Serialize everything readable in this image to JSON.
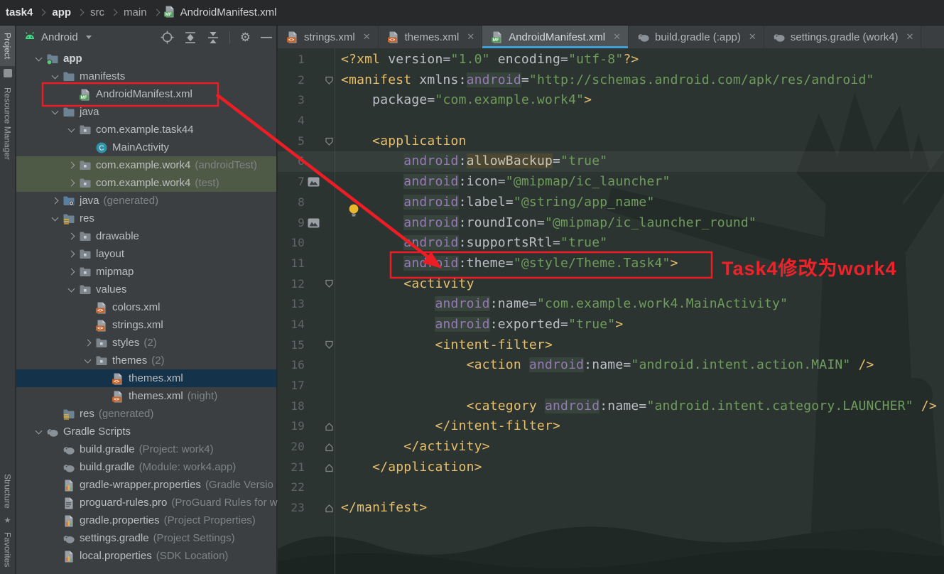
{
  "breadcrumb": {
    "path": [
      "task4",
      "app",
      "src",
      "main"
    ],
    "file": "AndroidManifest.xml"
  },
  "tool_strip": {
    "top": [
      {
        "label": "Project",
        "active": true
      },
      {
        "label": "Resource Manager",
        "active": false
      }
    ],
    "bottom": [
      {
        "label": "Structure",
        "active": false
      },
      {
        "label": "Favorites",
        "active": false
      }
    ]
  },
  "project_panel": {
    "view_selector": "Android",
    "toolbar_icons": [
      "locate",
      "expand-all",
      "collapse-all",
      "settings",
      "hide"
    ],
    "tree": [
      {
        "label": "app",
        "icon": "app-folder",
        "lvl": 0,
        "chev": "open",
        "bold": true
      },
      {
        "label": "manifests",
        "icon": "folder",
        "lvl": 1,
        "chev": "open"
      },
      {
        "label": "AndroidManifest.xml",
        "icon": "mf-file",
        "lvl": 2,
        "boxed": true
      },
      {
        "label": "java",
        "icon": "folder",
        "lvl": 1,
        "chev": "open"
      },
      {
        "label": "com.example.task44",
        "icon": "package",
        "lvl": 2,
        "chev": "open"
      },
      {
        "label": "MainActivity",
        "icon": "class",
        "lvl": 3
      },
      {
        "label": "com.example.work4",
        "suffix": "(androidTest)",
        "icon": "package",
        "lvl": 2,
        "chev": "closed",
        "state": "test-root"
      },
      {
        "label": "com.example.work4",
        "suffix": "(test)",
        "icon": "package",
        "lvl": 2,
        "chev": "closed",
        "state": "test-root"
      },
      {
        "label": "java",
        "suffix": "(generated)",
        "icon": "gen-folder",
        "lvl": 1,
        "chev": "closed"
      },
      {
        "label": "res",
        "icon": "res-folder",
        "lvl": 1,
        "chev": "open"
      },
      {
        "label": "drawable",
        "icon": "package",
        "lvl": 2,
        "chev": "closed"
      },
      {
        "label": "layout",
        "icon": "package",
        "lvl": 2,
        "chev": "closed"
      },
      {
        "label": "mipmap",
        "icon": "package",
        "lvl": 2,
        "chev": "closed"
      },
      {
        "label": "values",
        "icon": "package",
        "lvl": 2,
        "chev": "open"
      },
      {
        "label": "colors.xml",
        "icon": "xml-file",
        "lvl": 3
      },
      {
        "label": "strings.xml",
        "icon": "xml-file",
        "lvl": 3
      },
      {
        "label": "styles",
        "suffix": "(2)",
        "icon": "package",
        "lvl": 3,
        "chev": "closed"
      },
      {
        "label": "themes",
        "suffix": "(2)",
        "icon": "package",
        "lvl": 3,
        "chev": "open"
      },
      {
        "label": "themes.xml",
        "icon": "xml-file",
        "lvl": 4,
        "state": "selected"
      },
      {
        "label": "themes.xml",
        "suffix": "(night)",
        "icon": "xml-file",
        "lvl": 4
      },
      {
        "label": "res",
        "suffix": "(generated)",
        "icon": "res-folder",
        "lvl": 1
      },
      {
        "label": "Gradle Scripts",
        "icon": "gradle",
        "lvl": 0,
        "chev": "open"
      },
      {
        "label": "build.gradle",
        "suffix": "(Project: work4)",
        "icon": "gradle",
        "lvl": 1
      },
      {
        "label": "build.gradle",
        "suffix": "(Module: work4.app)",
        "icon": "gradle",
        "lvl": 1
      },
      {
        "label": "gradle-wrapper.properties",
        "suffix": "(Gradle Versio",
        "icon": "props",
        "lvl": 1
      },
      {
        "label": "proguard-rules.pro",
        "suffix": "(ProGuard Rules for w",
        "icon": "pro",
        "lvl": 1
      },
      {
        "label": "gradle.properties",
        "suffix": "(Project Properties)",
        "icon": "props",
        "lvl": 1
      },
      {
        "label": "settings.gradle",
        "suffix": "(Project Settings)",
        "icon": "gradle",
        "lvl": 1
      },
      {
        "label": "local.properties",
        "suffix": "(SDK Location)",
        "icon": "props",
        "lvl": 1
      }
    ]
  },
  "tabs": [
    {
      "label": "strings.xml",
      "icon": "xml-file",
      "active": false
    },
    {
      "label": "themes.xml",
      "icon": "xml-file",
      "active": false
    },
    {
      "label": "AndroidManifest.xml",
      "icon": "mf-file",
      "active": true
    },
    {
      "label": "build.gradle (:app)",
      "icon": "gradle",
      "active": false
    },
    {
      "label": "settings.gradle (work4)",
      "icon": "gradle",
      "active": false
    }
  ],
  "editor": {
    "lines": [
      {
        "n": 1,
        "tok": [
          [
            "tag",
            "<?xml"
          ],
          [
            "attr",
            " version="
          ],
          [
            "str",
            "\"1.0\""
          ],
          [
            "attr",
            " encoding="
          ],
          [
            "str",
            "\"utf-8\""
          ],
          [
            "tag",
            "?>"
          ]
        ]
      },
      {
        "n": 2,
        "fold": "down",
        "tok": [
          [
            "tag",
            "<manifest"
          ],
          [
            "attr",
            " xmlns:"
          ],
          [
            "nsh",
            "android"
          ],
          [
            "attr",
            "="
          ],
          [
            "str",
            "\"http://schemas.android.com/apk/res/android\""
          ]
        ]
      },
      {
        "n": 3,
        "tok": [
          [
            "pln",
            "    "
          ],
          [
            "attr",
            "package="
          ],
          [
            "str",
            "\"com.example.work4\""
          ],
          [
            "tag",
            ">"
          ]
        ]
      },
      {
        "n": 4,
        "tok": []
      },
      {
        "n": 5,
        "fold": "down",
        "tok": [
          [
            "pln",
            "    "
          ],
          [
            "tag",
            "<application"
          ]
        ]
      },
      {
        "n": 6,
        "caret": true,
        "bulb": true,
        "tok": [
          [
            "pln",
            "        "
          ],
          [
            "nsh",
            "android"
          ],
          [
            "attr",
            ":"
          ],
          [
            "attrhl",
            "allowBackup"
          ],
          [
            "attr",
            "="
          ],
          [
            "str",
            "\"true\""
          ]
        ]
      },
      {
        "n": 7,
        "img": true,
        "tok": [
          [
            "pln",
            "        "
          ],
          [
            "nsh",
            "android"
          ],
          [
            "attr",
            ":icon="
          ],
          [
            "str",
            "\"@mipmap/ic_launcher\""
          ]
        ]
      },
      {
        "n": 8,
        "tok": [
          [
            "pln",
            "        "
          ],
          [
            "nsh",
            "android"
          ],
          [
            "attr",
            ":label="
          ],
          [
            "str",
            "\"@string/app_name\""
          ]
        ]
      },
      {
        "n": 9,
        "img": true,
        "tok": [
          [
            "pln",
            "        "
          ],
          [
            "nsh",
            "android"
          ],
          [
            "attr",
            ":roundIcon="
          ],
          [
            "str",
            "\"@mipmap/ic_launcher_round\""
          ]
        ]
      },
      {
        "n": 10,
        "tok": [
          [
            "pln",
            "        "
          ],
          [
            "nsh",
            "android"
          ],
          [
            "attr",
            ":supportsRtl="
          ],
          [
            "str",
            "\"true\""
          ]
        ]
      },
      {
        "n": 11,
        "boxed": true,
        "tok": [
          [
            "pln",
            "        "
          ],
          [
            "nsh",
            "android"
          ],
          [
            "attr",
            ":theme="
          ],
          [
            "str",
            "\"@style/Theme.Task4\""
          ],
          [
            "tag",
            ">"
          ]
        ]
      },
      {
        "n": 12,
        "fold": "down",
        "tok": [
          [
            "pln",
            "        "
          ],
          [
            "tag",
            "<activity"
          ]
        ]
      },
      {
        "n": 13,
        "tok": [
          [
            "pln",
            "            "
          ],
          [
            "nsh",
            "android"
          ],
          [
            "attr",
            ":name="
          ],
          [
            "str",
            "\"com.example.work4.MainActivity\""
          ]
        ]
      },
      {
        "n": 14,
        "tok": [
          [
            "pln",
            "            "
          ],
          [
            "nsh",
            "android"
          ],
          [
            "attr",
            ":exported="
          ],
          [
            "str",
            "\"true\""
          ],
          [
            "tag",
            ">"
          ]
        ]
      },
      {
        "n": 15,
        "fold": "down",
        "tok": [
          [
            "pln",
            "            "
          ],
          [
            "tag",
            "<intent-filter>"
          ]
        ]
      },
      {
        "n": 16,
        "tok": [
          [
            "pln",
            "                "
          ],
          [
            "tag",
            "<action"
          ],
          [
            "pln",
            " "
          ],
          [
            "nsh",
            "android"
          ],
          [
            "attr",
            ":name="
          ],
          [
            "str",
            "\"android.intent.action.MAIN\""
          ],
          [
            "tag",
            " />"
          ]
        ]
      },
      {
        "n": 17,
        "tok": []
      },
      {
        "n": 18,
        "tok": [
          [
            "pln",
            "                "
          ],
          [
            "tag",
            "<category"
          ],
          [
            "pln",
            " "
          ],
          [
            "nsh",
            "android"
          ],
          [
            "attr",
            ":name="
          ],
          [
            "str",
            "\"android.intent.category.LAUNCHER\""
          ],
          [
            "tag",
            " />"
          ]
        ]
      },
      {
        "n": 19,
        "fold": "up",
        "tok": [
          [
            "pln",
            "            "
          ],
          [
            "tag",
            "</intent-filter>"
          ]
        ]
      },
      {
        "n": 20,
        "fold": "up",
        "tok": [
          [
            "pln",
            "        "
          ],
          [
            "tag",
            "</activity>"
          ]
        ]
      },
      {
        "n": 21,
        "fold": "up",
        "tok": [
          [
            "pln",
            "    "
          ],
          [
            "tag",
            "</application>"
          ]
        ]
      },
      {
        "n": 22,
        "tok": []
      },
      {
        "n": 23,
        "fold": "up",
        "tok": [
          [
            "tag",
            "</manifest>"
          ]
        ]
      }
    ]
  },
  "annotations": {
    "note": "Task4修改为work4",
    "highlighted_tree_item": "AndroidManifest.xml",
    "highlighted_code_line": 11
  },
  "colors": {
    "accent_blue": "#3da1da",
    "annotation_red": "#ec1d24",
    "tag_orange": "#e8bf6a",
    "string_green": "#6f9c5c",
    "namespace_purple": "#9878b8",
    "selection_navy": "#14324a",
    "test_root_olive": "#4e5a45"
  }
}
